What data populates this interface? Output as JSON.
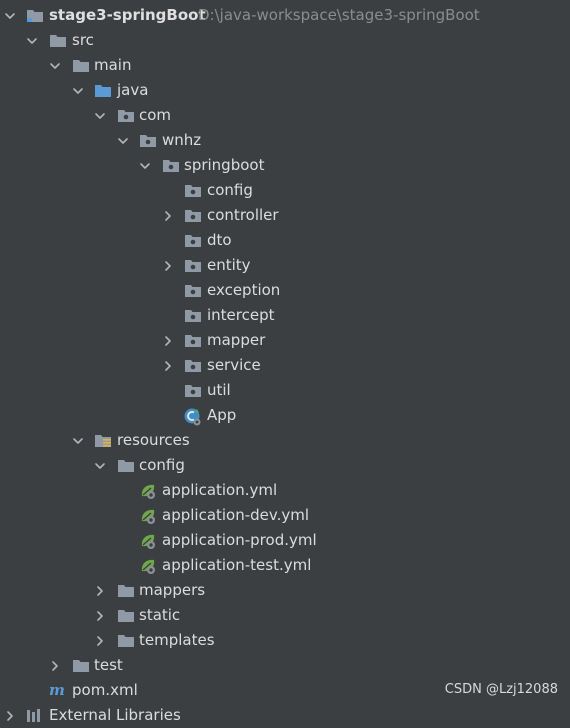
{
  "tree": {
    "root": {
      "name": "stage3-springBoot",
      "path": "D:\\java-workspace\\stage3-springBoot"
    },
    "src": "src",
    "main": "main",
    "java": "java",
    "com": "com",
    "wnhz": "wnhz",
    "springboot": "springboot",
    "packages": {
      "config": "config",
      "controller": "controller",
      "dto": "dto",
      "entity": "entity",
      "exception": "exception",
      "intercept": "intercept",
      "mapper": "mapper",
      "service": "service",
      "util": "util"
    },
    "app": "App",
    "resources": "resources",
    "res_config": "config",
    "yml_files": [
      "application.yml",
      "application-dev.yml",
      "application-prod.yml",
      "application-test.yml"
    ],
    "mappers": "mappers",
    "static": "static",
    "templates": "templates",
    "test": "test",
    "pom": "pom.xml",
    "external_libraries": "External Libraries"
  },
  "watermark": "CSDN @Lzj12088",
  "colors": {
    "background": "#3c3f41",
    "text": "#dcdcdc",
    "muted": "#8c8c8c",
    "folder": "#8f9aa6",
    "source_folder": "#5b9bd5",
    "spring": "#6fa74b"
  }
}
